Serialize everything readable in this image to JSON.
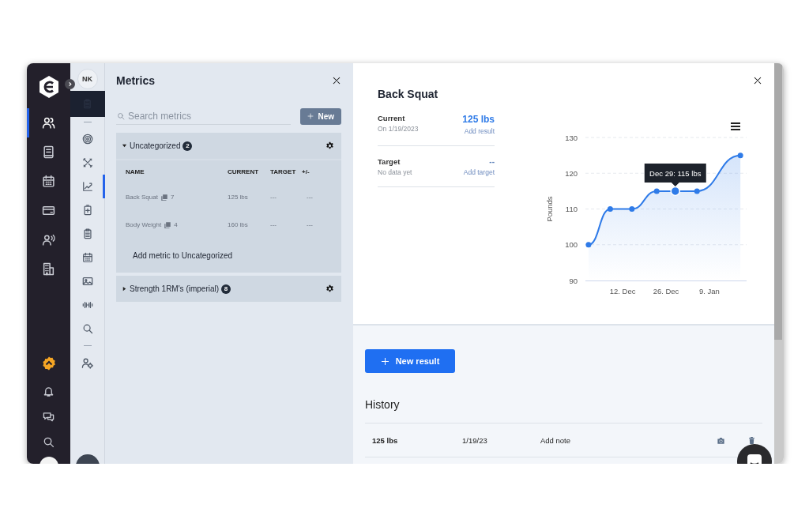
{
  "app_rail": {
    "items": [
      {
        "selected": true
      },
      {
        "selected": false
      },
      {
        "selected": false
      },
      {
        "selected": false
      },
      {
        "selected": false
      },
      {
        "selected": false
      }
    ]
  },
  "tool_rail": {
    "avatar_initials": "NK",
    "items": [
      {
        "selected": false
      },
      {
        "selected": false
      },
      {
        "selected": true
      },
      {
        "selected": false
      },
      {
        "selected": false
      },
      {
        "selected": false
      },
      {
        "selected": false
      },
      {
        "selected": false
      },
      {
        "selected": false
      }
    ]
  },
  "metrics_panel": {
    "title": "Metrics",
    "search": {
      "placeholder": "Search metrics"
    },
    "new_button": "New",
    "categories": [
      {
        "name": "Uncategorized",
        "count": "2",
        "expanded": true,
        "columns": [
          "NAME",
          "CURRENT",
          "TARGET",
          "+/-"
        ],
        "metrics": [
          {
            "name": "Back Squat",
            "results": "7",
            "current": "125 lbs",
            "target": "---",
            "change": "---"
          },
          {
            "name": "Body Weight",
            "results": "4",
            "current": "160 lbs",
            "target": "---",
            "change": "---"
          }
        ],
        "add_label": "Add metric to Uncategorized"
      },
      {
        "name": "Strength 1RM's (imperial)",
        "count": "8",
        "expanded": false
      }
    ]
  },
  "detail": {
    "title": "Back Squat",
    "stats": [
      {
        "label": "Current",
        "sub": "On 1/19/2023",
        "value": "125 lbs",
        "action": "Add result"
      },
      {
        "label": "Target",
        "sub": "No data yet",
        "value": "--",
        "action": "Add target"
      }
    ],
    "chart_data": {
      "type": "area",
      "ylabel": "Pounds",
      "x": [
        "2022-12-01",
        "2022-12-08",
        "2022-12-15",
        "2022-12-23",
        "2022-12-29",
        "2023-01-05",
        "2023-01-19"
      ],
      "grid": true,
      "series": [
        {
          "color": "#2f7be8",
          "values": [
            100,
            110,
            110,
            115,
            115,
            115,
            125
          ]
        }
      ],
      "xlim": [
        "2022-11-30",
        "2023-01-21"
      ],
      "ylim": [
        90,
        130
      ],
      "xticks": [
        {
          "value": "2022-12-12",
          "label": "12. Dec"
        },
        {
          "value": "2022-12-26",
          "label": "26. Dec"
        },
        {
          "value": "2023-01-09",
          "label": "9. Jan"
        }
      ],
      "yticks": [
        90,
        100,
        110,
        120,
        130
      ],
      "annotations": [
        {
          "x": "2022-12-29",
          "y": 115,
          "text": "Dec 29: 115 lbs"
        }
      ]
    },
    "new_result_button": "New result",
    "history": {
      "title": "History",
      "rows": [
        {
          "value": "125 lbs",
          "date": "1/19/23",
          "note": "Add note"
        }
      ]
    }
  }
}
